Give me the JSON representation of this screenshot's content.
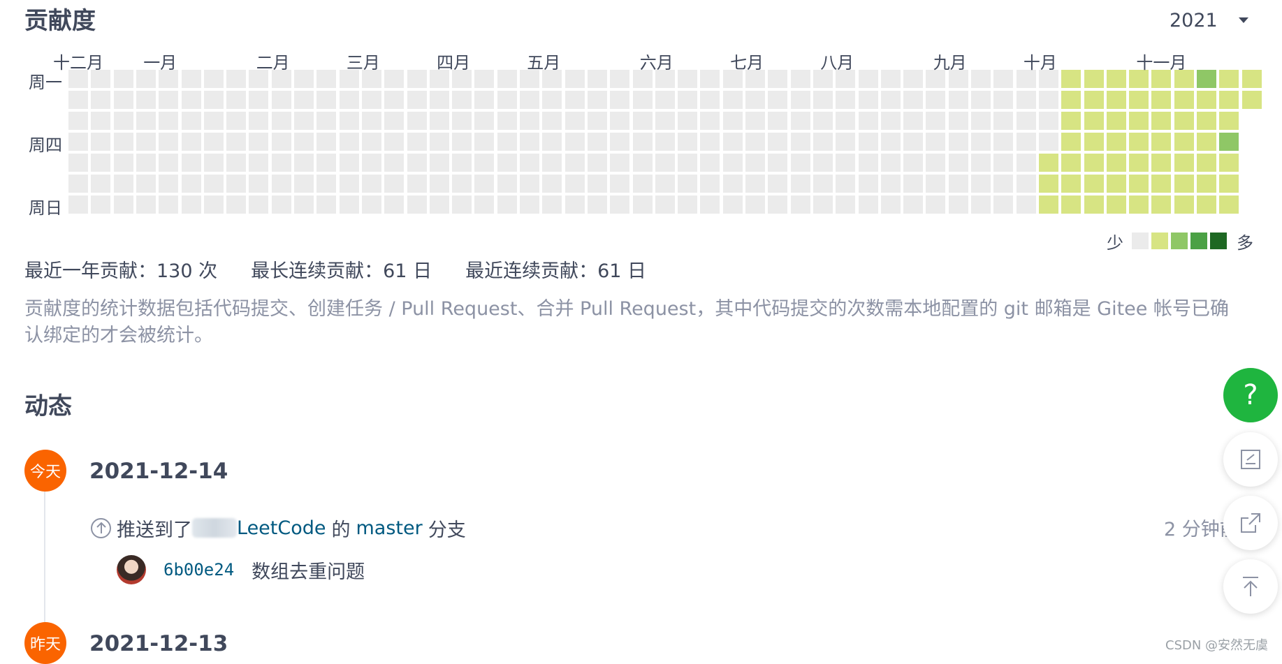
{
  "contrib": {
    "title": "贡献度",
    "year": "2021",
    "months": [
      {
        "label": "十二月",
        "col": 0
      },
      {
        "label": "一月",
        "col": 4
      },
      {
        "label": "二月",
        "col": 9
      },
      {
        "label": "三月",
        "col": 13
      },
      {
        "label": "四月",
        "col": 17
      },
      {
        "label": "五月",
        "col": 21
      },
      {
        "label": "六月",
        "col": 26
      },
      {
        "label": "七月",
        "col": 30
      },
      {
        "label": "八月",
        "col": 34
      },
      {
        "label": "九月",
        "col": 39
      },
      {
        "label": "十月",
        "col": 43
      },
      {
        "label": "十一月",
        "col": 48
      }
    ],
    "days": [
      {
        "label": "周一",
        "row": 0
      },
      {
        "label": "周四",
        "row": 3
      },
      {
        "label": "周日",
        "row": 6
      }
    ],
    "weeks": 53,
    "active": [
      {
        "col": 43,
        "from": 4,
        "to": 6,
        "level": 1
      },
      {
        "col": 44,
        "from": 0,
        "to": 6,
        "level": 1
      },
      {
        "col": 45,
        "from": 0,
        "to": 6,
        "level": 1
      },
      {
        "col": 46,
        "from": 0,
        "to": 6,
        "level": 1
      },
      {
        "col": 47,
        "from": 0,
        "to": 6,
        "level": 1
      },
      {
        "col": 48,
        "from": 0,
        "to": 6,
        "level": 1
      },
      {
        "col": 49,
        "from": 0,
        "to": 6,
        "level": 1
      },
      {
        "col": 50,
        "from": 0,
        "to": 6,
        "level": 1
      },
      {
        "col": 51,
        "from": 0,
        "to": 6,
        "level": 1
      },
      {
        "col": 52,
        "from": 0,
        "to": 1,
        "level": 1
      }
    ],
    "highlights": [
      {
        "col": 50,
        "row": 0,
        "level": 2
      },
      {
        "col": 51,
        "row": 3,
        "level": 2
      }
    ],
    "colors": [
      "#ebebeb",
      "#d7e483",
      "#8fc766",
      "#4ba145",
      "#1e6823"
    ],
    "legend_less": "少",
    "legend_more": "多",
    "stats": {
      "year_total": "最近一年贡献：130 次",
      "longest_streak": "最长连续贡献：61 日",
      "current_streak": "最近连续贡献：61 日"
    },
    "note": "贡献度的统计数据包括代码提交、创建任务 / Pull Request、合并 Pull Request，其中代码提交的次数需本地配置的 git 邮箱是 Gitee 帐号已确认绑定的才会被统计。"
  },
  "feed": {
    "title": "动态",
    "groups": [
      {
        "badge": "今天",
        "date": "2021-12-14"
      },
      {
        "badge": "昨天",
        "date": "2021-12-13"
      }
    ],
    "push": {
      "prefix": "推送到了",
      "repo": "LeetCode",
      "middle": "的",
      "branch": "master",
      "suffix": "分支",
      "time": "2 分钟前",
      "commit_hash": "6b00e24",
      "commit_msg": "数组去重问题"
    }
  },
  "watermark": "CSDN @安然无虞",
  "fab": {
    "help": "?"
  }
}
